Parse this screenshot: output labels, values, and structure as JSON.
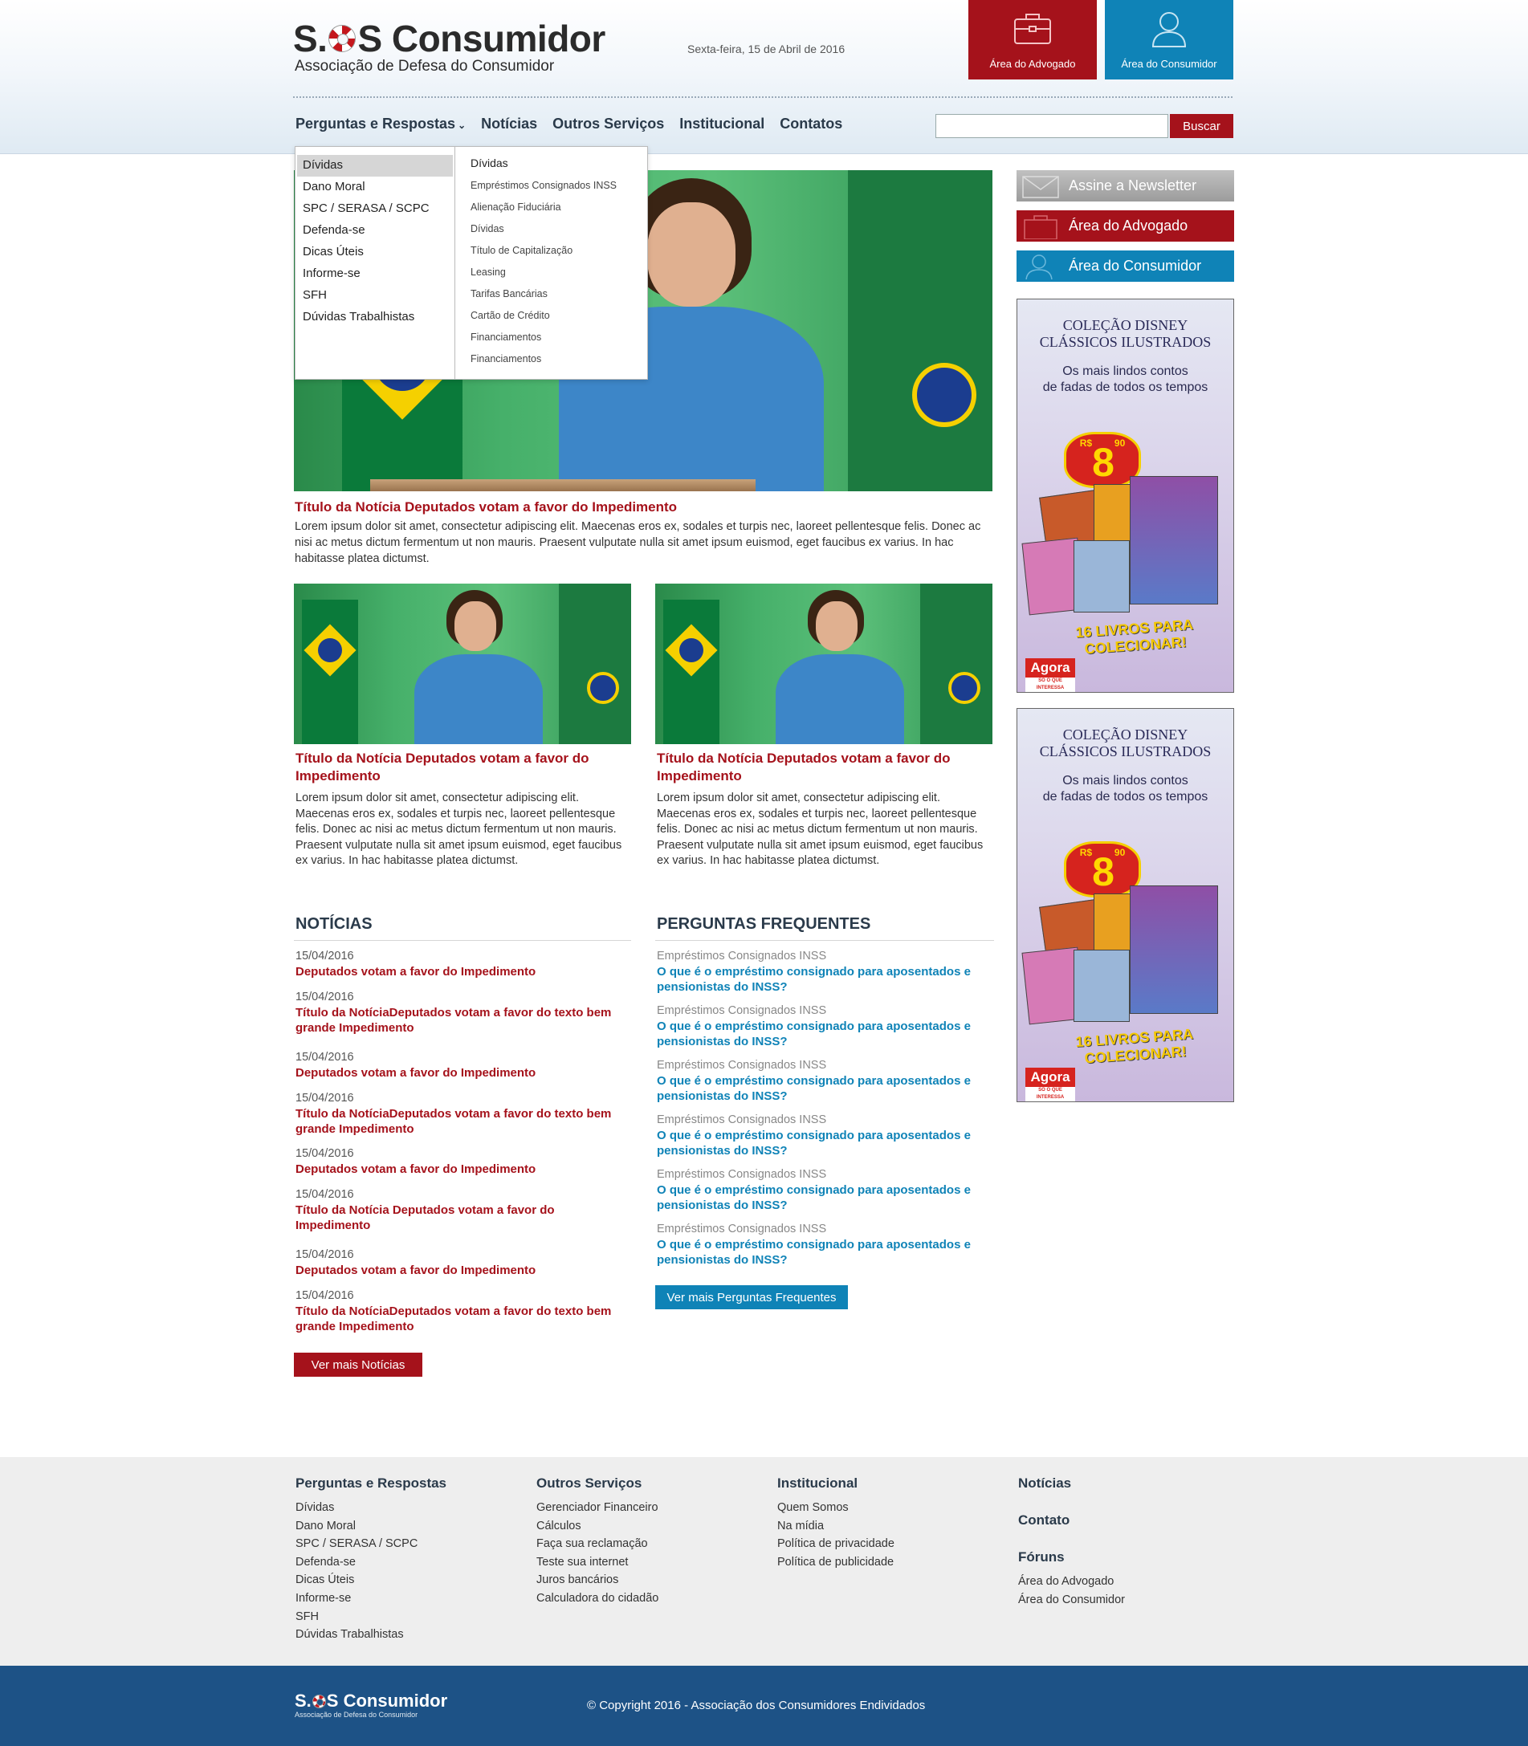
{
  "header": {
    "logo_prefix": "S.",
    "logo_suffix": "S Consumidor",
    "logo_subtitle": "Associação de Defesa do Consumidor",
    "date": "Sexta-feira, 15 de Abril de 2016",
    "tile_advogado": "Área do Advogado",
    "tile_consumidor": "Área do Consumidor"
  },
  "nav": {
    "items": [
      "Perguntas e Respostas",
      "Notícias",
      "Outros Serviços",
      "Institucional",
      "Contatos"
    ],
    "search_value": "",
    "search_button": "Buscar"
  },
  "dropdown": {
    "col1": [
      "Dívidas",
      "Dano Moral",
      "SPC / SERASA / SCPC",
      "Defenda-se",
      "Dicas Úteis",
      "Informe-se",
      "SFH",
      "Dúvidas Trabalhistas"
    ],
    "active_index": 0,
    "col2_heading": "Dívidas",
    "col2": [
      "Empréstimos Consignados INSS",
      "Alienação Fiduciária",
      "Dívidas",
      "Título de Capitalização",
      "Leasing",
      "Tarifas Bancárias",
      "Cartão de Crédito",
      "Financiamentos",
      "Financiamentos"
    ]
  },
  "hero": {
    "title": "Título da Notícia Deputados votam a favor do Impedimento",
    "text": "Lorem ipsum dolor sit amet, consectetur adipiscing elit. Maecenas eros ex, sodales et turpis nec, laoreet pellentesque felis. Donec ac nisi ac metus dictum fermentum ut non mauris. Praesent vulputate nulla sit amet ipsum euismod, eget faucibus ex varius. In hac habitasse platea dictumst."
  },
  "cards": [
    {
      "title": "Título da Notícia Deputados votam a favor do Impedimento",
      "text": "Lorem ipsum dolor sit amet, consectetur adipiscing elit. Maecenas eros ex, sodales et turpis nec, laoreet pellentesque felis. Donec ac nisi ac metus dictum fermentum ut non mauris. Praesent vulputate nulla sit amet ipsum euismod, eget faucibus ex varius. In hac habitasse platea dictumst."
    },
    {
      "title": "Título da Notícia Deputados votam a favor do Impedimento",
      "text": "Lorem ipsum dolor sit amet, consectetur adipiscing elit. Maecenas eros ex, sodales et turpis nec, laoreet pellentesque felis. Donec ac nisi ac metus dictum fermentum ut non mauris. Praesent vulputate nulla sit amet ipsum euismod, eget faucibus ex varius. In hac habitasse platea dictumst."
    }
  ],
  "news": {
    "title": "NOTÍCIAS",
    "items": [
      {
        "date": "15/04/2016",
        "title": "Deputados votam a favor do Impedimento"
      },
      {
        "date": "15/04/2016",
        "title": "Título da NotíciaDeputados votam a favor do texto bem grande Impedimento"
      },
      {
        "date": "15/04/2016",
        "title": "Deputados votam a favor do Impedimento"
      },
      {
        "date": "15/04/2016",
        "title": "Título da NotíciaDeputados votam a favor do texto bem grande Impedimento"
      },
      {
        "date": "15/04/2016",
        "title": "Deputados votam a favor do Impedimento"
      },
      {
        "date": "15/04/2016",
        "title": "Título da Notícia Deputados votam a favor do Impedimento"
      },
      {
        "date": "15/04/2016",
        "title": "Deputados votam a favor do Impedimento"
      },
      {
        "date": "15/04/2016",
        "title": "Título da NotíciaDeputados votam a favor do texto bem grande Impedimento"
      }
    ],
    "more_button": "Ver mais Notícias"
  },
  "faq": {
    "title": "PERGUNTAS FREQUENTES",
    "items": [
      {
        "category": "Empréstimos Consignados INSS",
        "question": "O que é o empréstimo consignado para aposentados e pensionistas do INSS?"
      },
      {
        "category": "Empréstimos Consignados INSS",
        "question": "O que é o empréstimo consignado para aposentados e pensionistas do INSS?"
      },
      {
        "category": "Empréstimos Consignados INSS",
        "question": "O que é o empréstimo consignado para aposentados e pensionistas do INSS?"
      },
      {
        "category": "Empréstimos Consignados INSS",
        "question": "O que é o empréstimo consignado para aposentados e pensionistas do INSS?"
      },
      {
        "category": "Empréstimos Consignados INSS",
        "question": "O que é o empréstimo consignado para aposentados e pensionistas do INSS?"
      },
      {
        "category": "Empréstimos Consignados INSS",
        "question": "O que é o empréstimo consignado para aposentados e pensionistas do INSS?"
      }
    ],
    "more_button": "Ver mais Perguntas Frequentes"
  },
  "sidebar": {
    "newsletter": "Assine a Newsletter",
    "advogado": "Área do Advogado",
    "consumidor": "Área do Consumidor",
    "ad": {
      "title_line1": "COLEÇÃO DISNEY",
      "title_line2": "CLÁSSICOS ILUSTRADOS",
      "sub_line1": "Os mais lindos contos",
      "sub_line2": "de fadas de todos os tempos",
      "price_currency": "R$",
      "price": "8",
      "price_cents": "90",
      "slogan": "16 LIVROS PARA COLECIONAR!",
      "brand": "Agora",
      "brand_tag": "SÓ O QUE INTERESSA"
    }
  },
  "footer": {
    "col1": {
      "heading": "Perguntas e Respostas",
      "links": [
        "Dívidas",
        "Dano Moral",
        "SPC / SERASA / SCPC",
        "Defenda-se",
        "Dicas Úteis",
        "Informe-se",
        "SFH",
        "Dúvidas Trabalhistas"
      ]
    },
    "col2": {
      "heading": "Outros Serviços",
      "links": [
        "Gerenciador Financeiro",
        "Cálculos",
        "Faça sua reclamação",
        "Teste sua internet",
        "Juros bancários",
        "Calculadora do cidadão"
      ]
    },
    "col3": {
      "heading": "Institucional",
      "links": [
        "Quem Somos",
        "Na mídia",
        "Política de privacidade",
        "Política de publicidade"
      ]
    },
    "col4": {
      "heading1": "Notícias",
      "heading2": "Contato",
      "heading3": "Fóruns",
      "links": [
        "Área do Advogado",
        "Área do Consumidor"
      ]
    },
    "copyright": "© Copyright 2016 - Associação dos Consumidores Endividados"
  },
  "colors": {
    "brand_red": "#a5121b",
    "brand_blue": "#0f83b7",
    "footer_blue": "#1d5286"
  },
  "icons": [
    "lifebuoy-icon",
    "briefcase-icon",
    "user-icon",
    "chevron-down-icon",
    "envelope-icon"
  ]
}
